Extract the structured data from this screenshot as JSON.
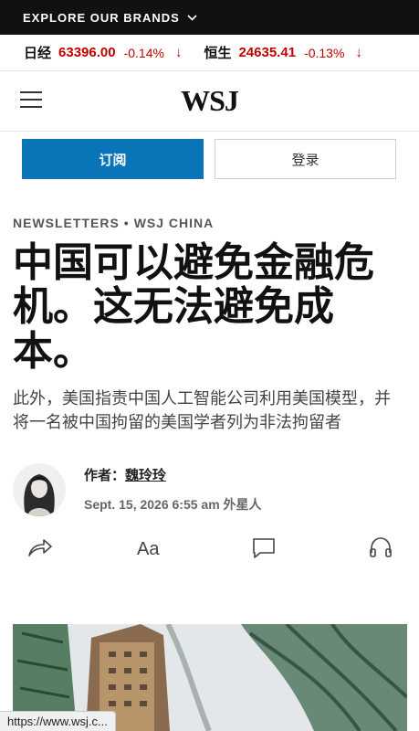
{
  "brands_bar": {
    "label": "EXPLORE OUR BRANDS"
  },
  "ticker": [
    {
      "name": "日经",
      "value": "63396.00",
      "change": "-0.14%",
      "arrow": "↓"
    },
    {
      "name": "恒生",
      "value": "24635.41",
      "change": "-0.13%",
      "arrow": "↓"
    }
  ],
  "header": {
    "logo": "WSJ"
  },
  "auth": {
    "subscribe": "订阅",
    "login": "登录"
  },
  "article": {
    "section": "NEWSLETTERS",
    "section_sep": "•",
    "subsection": "WSJ CHINA",
    "headline": "中国可以避免金融危机。这无法避免成本。",
    "dek": "此外，美国指责中国人工智能公司利用美国模型，并将一名被中国拘留的美国学者列为非法拘留者",
    "author_prefix": "作者：",
    "author_name": "魏玲玲",
    "date": "Sept. 15, 2026 6:55 am 外星人"
  },
  "status_bar": {
    "url": "https://www.wsj.c..."
  },
  "colors": {
    "accent": "#0a74b9",
    "negative": "#c20000"
  },
  "icons": [
    "chevron-down-icon",
    "arrow-down-icon",
    "menu-icon",
    "share-icon",
    "text-size-icon",
    "comment-icon",
    "headphones-icon"
  ]
}
